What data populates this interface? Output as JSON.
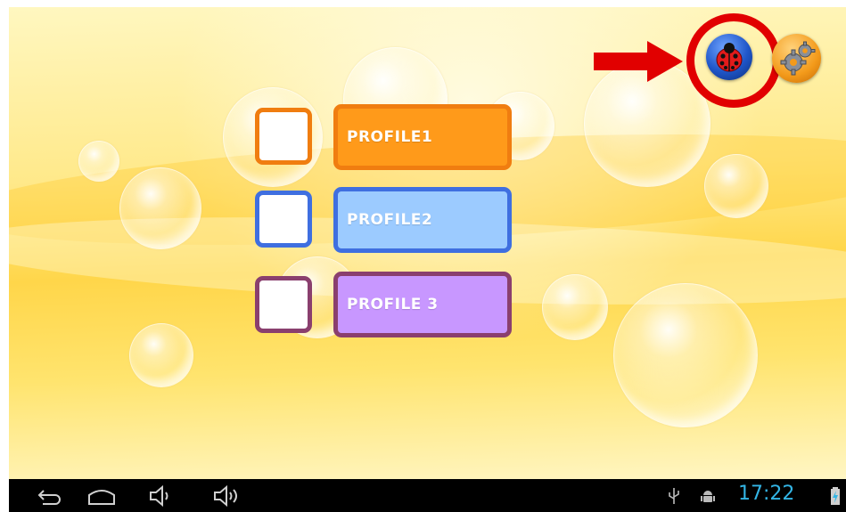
{
  "profiles": [
    {
      "label": "PROFILE1",
      "accent": "#f07d10",
      "fill": "#ff9a1a"
    },
    {
      "label": "PROFILE2",
      "accent": "#3f6fe0",
      "fill": "#9ccbff"
    },
    {
      "label": "PROFILE 3",
      "accent": "#8a3f6e",
      "fill": "#c897ff"
    }
  ],
  "toolbar": {
    "ladybug_icon": "ladybug-icon",
    "settings_icon": "gears-icon"
  },
  "annotation": {
    "highlight_color": "#e10000"
  },
  "statusbar": {
    "time": "17:22",
    "clock_color": "#33b5e5",
    "nav_icons": [
      "back-icon",
      "home-icon",
      "volume-down-icon",
      "volume-up-icon"
    ],
    "status_icons": [
      "usb-icon",
      "android-debug-icon",
      "battery-icon"
    ]
  }
}
